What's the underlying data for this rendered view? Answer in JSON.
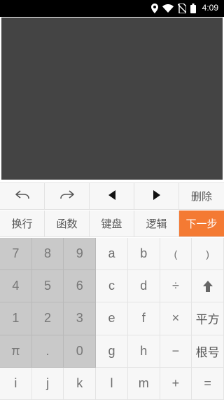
{
  "status_bar": {
    "time": "4:09",
    "icons": [
      "location-icon",
      "wifi-icon",
      "no-sim-icon",
      "battery-icon"
    ]
  },
  "display": {
    "background_color": "#444444"
  },
  "controls": {
    "undo_icon": "undo-arrow",
    "redo_icon": "redo-arrow",
    "left_icon": "triangle-left",
    "right_icon": "triangle-right",
    "delete_label": "删除"
  },
  "modes": {
    "items": [
      "换行",
      "函数",
      "键盘",
      "逻辑"
    ],
    "next_label": "下一步",
    "next_color": "#f47a33"
  },
  "keypad": {
    "keys": [
      [
        "7",
        "8",
        "9",
        "a",
        "b",
        "(",
        ")"
      ],
      [
        "4",
        "5",
        "6",
        "c",
        "d",
        "÷",
        "⇧"
      ],
      [
        "1",
        "2",
        "3",
        "e",
        "f",
        "×",
        "平方"
      ],
      [
        "π",
        ".",
        "0",
        "g",
        "h",
        "−",
        "根号"
      ],
      [
        "i",
        "j",
        "k",
        "l",
        "m",
        "+",
        "="
      ]
    ]
  }
}
